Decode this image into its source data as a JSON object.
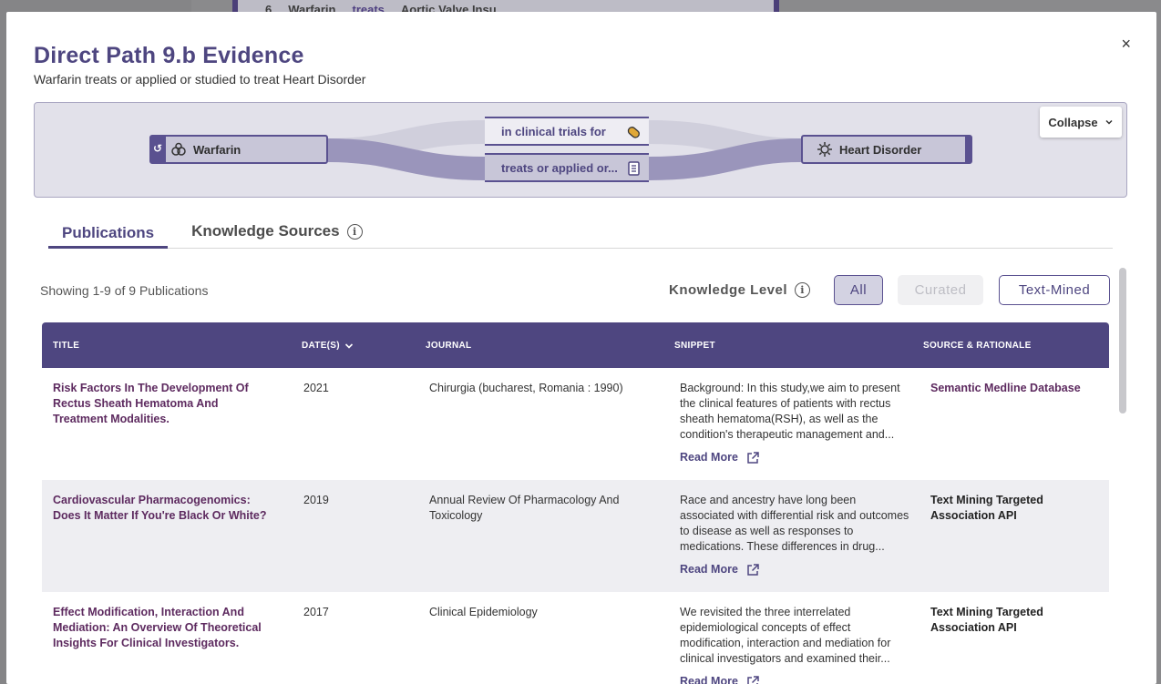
{
  "background": {
    "crumb_count": "6",
    "crumb_subject": "Warfarin",
    "crumb_pred": "treats",
    "crumb_object": "Aortic Valve Insu..."
  },
  "modal": {
    "title": "Direct Path 9.b Evidence",
    "subtitle": "Warfarin treats or applied or studied to treat Heart Disorder",
    "close_label": "×"
  },
  "path": {
    "subject": "Warfarin",
    "object": "Heart Disorder",
    "predicates": [
      "in clinical trials for",
      "treats or applied or..."
    ],
    "collapse_label": "Collapse"
  },
  "tabs": [
    {
      "label": "Publications",
      "active": true
    },
    {
      "label": "Knowledge Sources",
      "active": false
    }
  ],
  "results": {
    "showing": "Showing 1-9 of 9 Publications",
    "knowledge_level_label": "Knowledge Level",
    "filters": [
      "All",
      "Curated",
      "Text-Mined"
    ]
  },
  "table": {
    "headers": [
      "TITLE",
      "DATE(S)",
      "JOURNAL",
      "SNIPPET",
      "SOURCE & RATIONALE"
    ],
    "read_more_label": "Read More",
    "rows": [
      {
        "title": "Risk Factors In The Development Of Rectus Sheath Hematoma And Treatment Modalities.",
        "date": "2021",
        "journal": "Chirurgia (bucharest, Romania : 1990)",
        "snippet": "Background: In this study,we aim to present the clinical features of patients with rectus sheath hematoma(RSH), as well as the condition's therapeutic management and...",
        "source": "Semantic Medline Database"
      },
      {
        "title": "Cardiovascular Pharmacogenomics: Does It Matter If You're Black Or White?",
        "date": "2019",
        "journal": "Annual Review Of Pharmacology And Toxicology",
        "snippet": "Race and ancestry have long been associated with differential risk and outcomes to disease as well as responses to medications. These differences in drug...",
        "source": "Text Mining Targeted Association API"
      },
      {
        "title": "Effect Modification, Interaction And Mediation: An Overview Of Theoretical Insights For Clinical Investigators.",
        "date": "2017",
        "journal": "Clinical Epidemiology",
        "snippet": "We revisited the three interrelated epidemiological concepts of effect modification, interaction and mediation for clinical investigators and examined their...",
        "source": "Text Mining Targeted Association API"
      }
    ]
  },
  "colors": {
    "brand": "#4e4680",
    "title_link": "#5d2a5f",
    "row_alt": "#eeeef2"
  }
}
